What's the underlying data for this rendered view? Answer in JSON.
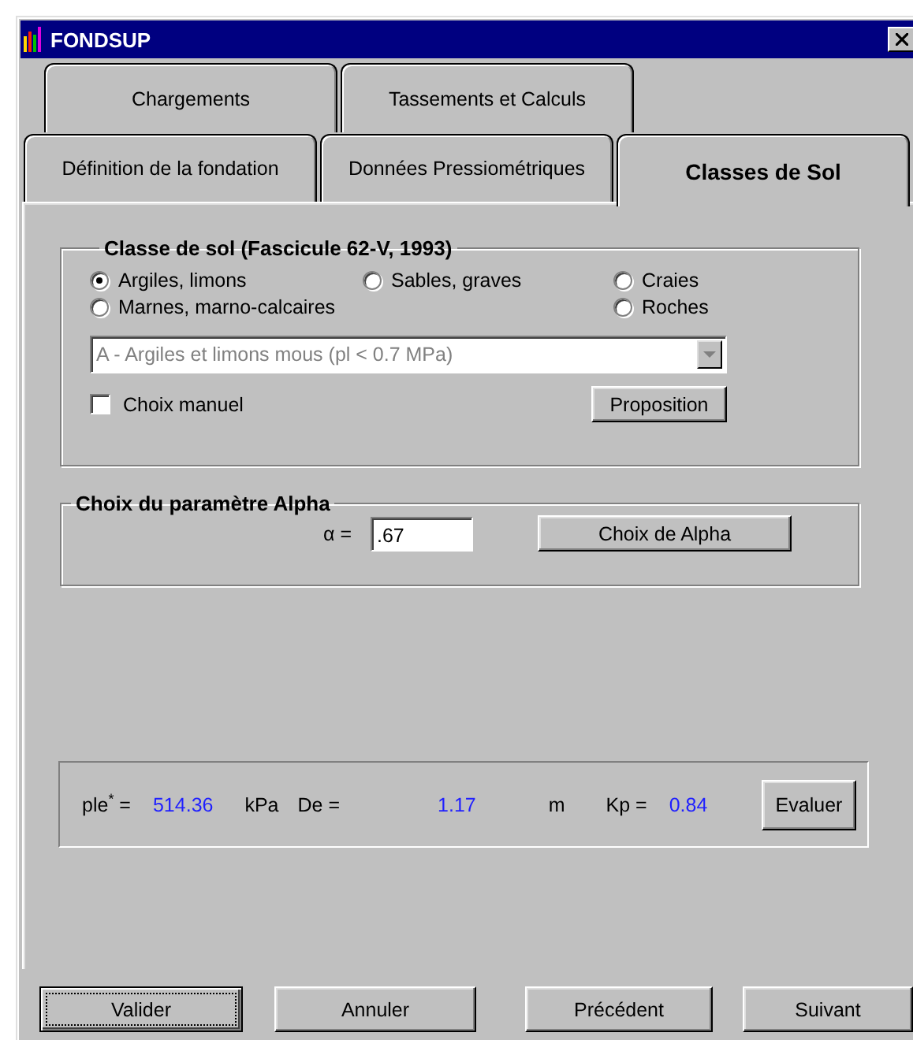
{
  "window": {
    "title": "FONDSUP"
  },
  "tab_rows": [
    [
      {
        "label": "Chargements",
        "selected": false
      },
      {
        "label": "Tassements et Calculs",
        "selected": false
      }
    ],
    [
      {
        "label": "Définition de la fondation",
        "selected": false
      },
      {
        "label": "Données Pressiométriques",
        "selected": false
      },
      {
        "label": "Classes de Sol",
        "selected": true
      }
    ]
  ],
  "soil_class": {
    "title": "Classe de sol (Fascicule 62-V, 1993)",
    "option_rows": [
      [
        {
          "label": "Argiles, limons",
          "selected": true
        },
        {
          "label": "Sables, graves",
          "selected": false
        },
        {
          "label": "Craies",
          "selected": false
        }
      ],
      [
        {
          "label": "Marnes, marno-calcaires",
          "selected": false
        },
        {
          "label": "Roches",
          "selected": false
        }
      ]
    ],
    "dropdown": {
      "value": "A - Argiles et limons mous (pl < 0.7 MPa)",
      "disabled": true
    },
    "manual_choice": {
      "label": "Choix manuel",
      "checked": false
    },
    "proposal_button": "Proposition"
  },
  "alpha": {
    "title": "Choix du paramètre Alpha",
    "label": "α =",
    "value": ".67",
    "button": "Choix de Alpha"
  },
  "results": {
    "items": [
      {
        "label": "ple$^{*}$ =",
        "value": "514.36",
        "unit": "kPa"
      },
      {
        "label": "De =",
        "value": "1.17",
        "unit": "m"
      },
      {
        "label": "Kp =",
        "value": "0.84"
      }
    ],
    "button": "Evaluer"
  },
  "buttons": [
    {
      "label": "Valider",
      "focused": true
    },
    {
      "label": "Annuler",
      "focused": false
    },
    {
      "label": "Précédent",
      "focused": false
    },
    {
      "label": "Suivant",
      "focused": false
    }
  ]
}
